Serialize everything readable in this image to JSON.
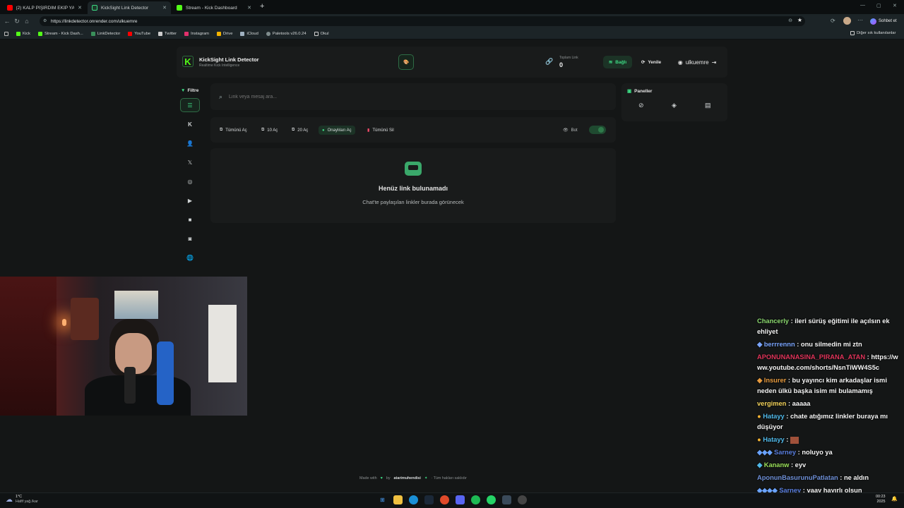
{
  "browser": {
    "tabs": [
      {
        "label": "(2) KALP PİŞİRDİM EKİP YAN YATI",
        "color": "#ff0000"
      },
      {
        "label": "KickSight Link Detector",
        "color": "#53fc18"
      },
      {
        "label": "Stream - Kick Dashboard",
        "color": "#53fc18"
      }
    ],
    "new_tab": "+",
    "url": "https://linkdetector.onrender.com/ulkuemre",
    "chat_button": "Sohbet et",
    "bookmarks": [
      {
        "label": "Kick",
        "color": "#53fc18"
      },
      {
        "label": "Stream - Kick Dash...",
        "color": "#53fc18"
      },
      {
        "label": "LinkDetector",
        "color": "#3a8f5a"
      },
      {
        "label": "YouTube",
        "color": "#ff0000"
      },
      {
        "label": "Twitter",
        "color": "#cccccc"
      },
      {
        "label": "Instagram",
        "color": "#e1306c"
      },
      {
        "label": "Drive",
        "color": "#f4b400"
      },
      {
        "label": "iCloud",
        "color": "#9fb0c0"
      },
      {
        "label": "Paletools v26.0.24",
        "color": "#7f8c8d"
      },
      {
        "label": "Okul",
        "color": "#d0d0d0"
      }
    ],
    "other_bookmarks": "Diğer sık kullanılanlar"
  },
  "header": {
    "brand": "KickSight Link Detector",
    "tagline": "Realtime Kick Intelligence",
    "total_label": "Toplam Link",
    "total_value": "0",
    "connect": "Bağlı",
    "refresh": "Yenile",
    "user": "ulkuemre"
  },
  "sidebar": {
    "filter_label": "Filtre"
  },
  "search": {
    "placeholder": "Link veya mesaj ara..."
  },
  "actions": {
    "open_all": "Tümünü Aç",
    "open_10": "10 Aç",
    "open_20": "20 Aç",
    "open_approved": "Onaylıları Aç",
    "delete_all": "Tümünü Sil",
    "bot": "Bot"
  },
  "empty": {
    "title": "Henüz link bulunamadı",
    "subtitle": "Chat'te paylaşılan linkler burada görünecek"
  },
  "panels": {
    "title": "Paneller"
  },
  "footer": {
    "made_with": "Made with",
    "by": "by",
    "author": "atarimuhendisi",
    "rights": "· Tüm hakları saklıdır"
  },
  "chat": [
    {
      "user": "Chancerly",
      "color": "#8bd86f",
      "text": ": ileri sürüş eğitimi ile açılsın ek ehliyet"
    },
    {
      "user": "berrrennn",
      "color": "#7aa5ff",
      "text": ": onu silmedin mi ztn"
    },
    {
      "user": "APONUNANASINA_PIRANA_ATAN",
      "color": "#e0345a",
      "text": ": https://www.youtube.com/shorts/NsnTiWW4S5c"
    },
    {
      "user": "Insurer",
      "color": "#e69a3e",
      "text": ": bu yayıncı kim arkadaşlar ismi neden ülkü başka isim mi bulamamış"
    },
    {
      "user": "vergimen",
      "color": "#f2d25a",
      "text": ": aaaaa"
    },
    {
      "user": "Hatayy",
      "color": "#4fb8e8",
      "text": ": chate atığımız linkler buraya mı düşüyor"
    },
    {
      "user": "Hatayy",
      "color": "#4fb8e8",
      "text": ":"
    },
    {
      "user": "Sarney",
      "color": "#5a7fe0",
      "text": ": noluyo ya"
    },
    {
      "user": "Kananw",
      "color": "#9be05a",
      "text": ": eyv"
    },
    {
      "user": "AponunBasurunuPatlatan",
      "color": "#6e8fd6",
      "text": ": ne aldın"
    },
    {
      "user": "Sarney",
      "color": "#5a7fe0",
      "text": ": vaay hayırlı olsun"
    }
  ],
  "system": {
    "weather_temp": "1°C",
    "weather_desc": "Hafif yağ./kar",
    "time": "00:23",
    "date": "2025"
  },
  "colors": {
    "accent": "#3ddc84",
    "kick": "#53fc18",
    "danger": "#ff4d6d"
  }
}
